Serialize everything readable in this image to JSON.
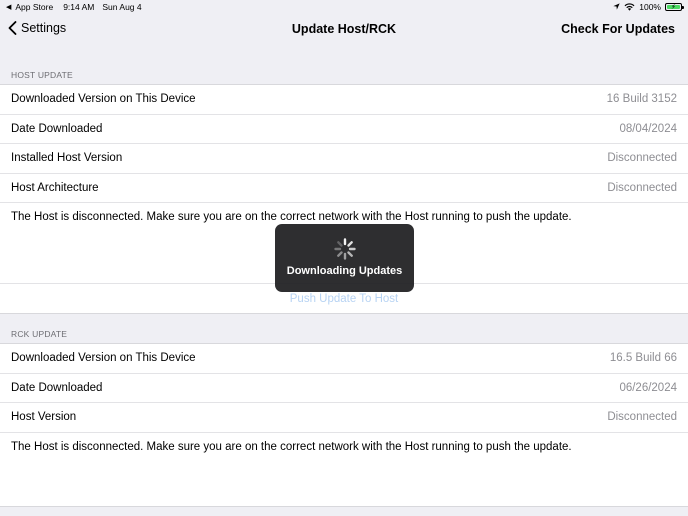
{
  "status_bar": {
    "back_app": "App Store",
    "time": "9:14 AM",
    "date": "Sun Aug 4",
    "battery": "100%"
  },
  "nav": {
    "back_label": "Settings",
    "title": "Update Host/RCK",
    "right_action": "Check For Updates"
  },
  "host_update": {
    "header": "HOST UPDATE",
    "rows": [
      {
        "label": "Downloaded Version on This Device",
        "value": "16 Build 3152"
      },
      {
        "label": "Date Downloaded",
        "value": "08/04/2024"
      },
      {
        "label": "Installed Host Version",
        "value": "Disconnected"
      },
      {
        "label": "Host Architecture",
        "value": "Disconnected"
      }
    ],
    "note": "The Host is disconnected. Make sure you are on the correct network with the Host running to push the update.",
    "push_button": "Push Update To Host"
  },
  "rck_update": {
    "header": "RCK UPDATE",
    "rows": [
      {
        "label": "Downloaded Version on This Device",
        "value": "16.5 Build 66"
      },
      {
        "label": "Date Downloaded",
        "value": "06/26/2024"
      },
      {
        "label": "Host Version",
        "value": "Disconnected"
      }
    ],
    "note": "The Host is disconnected. Make sure you are on the correct network with the Host running to push the update."
  },
  "hud": {
    "label": "Downloading Updates"
  },
  "colors": {
    "background": "#efeff4",
    "secondary_text": "#8e8e93",
    "disabled_link": "#b7d3f3",
    "hud_background": "#1e1e20",
    "battery": "#4cd964"
  }
}
